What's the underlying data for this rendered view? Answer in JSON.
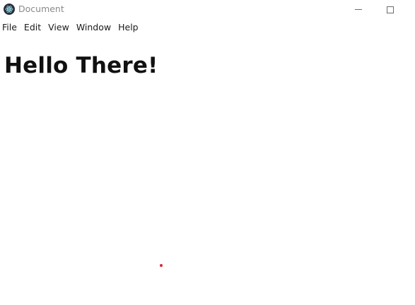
{
  "window": {
    "title": "Document",
    "app_icon": "electron-atom-icon",
    "controls": [
      "minimize",
      "maximize"
    ]
  },
  "menubar": {
    "items": [
      {
        "label": "File"
      },
      {
        "label": "Edit"
      },
      {
        "label": "View"
      },
      {
        "label": "Window"
      },
      {
        "label": "Help"
      }
    ]
  },
  "content": {
    "heading": "Hello There!"
  },
  "colors": {
    "background": "#ffffff",
    "title_text": "#8a8a8a",
    "heading_text": "#111111",
    "cursor_dot": "#e0203a"
  }
}
